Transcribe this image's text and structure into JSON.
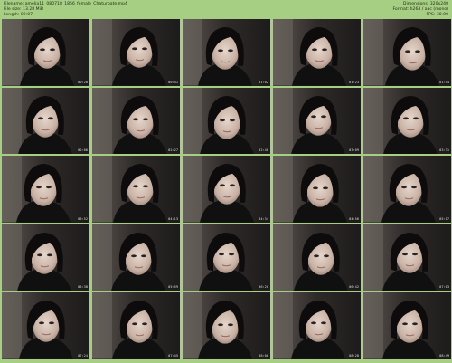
{
  "header": {
    "filename": "Filename: amelia11_080718_1856_female_Chaturbate.mp4",
    "filesize": "File size: 13.28 MiB",
    "length": "Length: 09:07",
    "dimensions": "Dimensions: 320x240",
    "format": "Format: h264 / aac (mono)",
    "fps": "FPS: 30.00"
  },
  "thumbnails": [
    {
      "time": "00:20"
    },
    {
      "time": "00:41"
    },
    {
      "time": "01:02"
    },
    {
      "time": "01:23"
    },
    {
      "time": "01:44"
    },
    {
      "time": "02:06"
    },
    {
      "time": "02:27"
    },
    {
      "time": "02:48"
    },
    {
      "time": "03:09"
    },
    {
      "time": "03:31"
    },
    {
      "time": "03:52"
    },
    {
      "time": "04:13"
    },
    {
      "time": "04:34"
    },
    {
      "time": "04:56"
    },
    {
      "time": "05:17"
    },
    {
      "time": "05:38"
    },
    {
      "time": "05:59"
    },
    {
      "time": "06:20"
    },
    {
      "time": "06:42"
    },
    {
      "time": "07:03"
    },
    {
      "time": "07:24"
    },
    {
      "time": "07:45"
    },
    {
      "time": "08:06"
    },
    {
      "time": "08:28"
    },
    {
      "time": "08:49"
    }
  ]
}
